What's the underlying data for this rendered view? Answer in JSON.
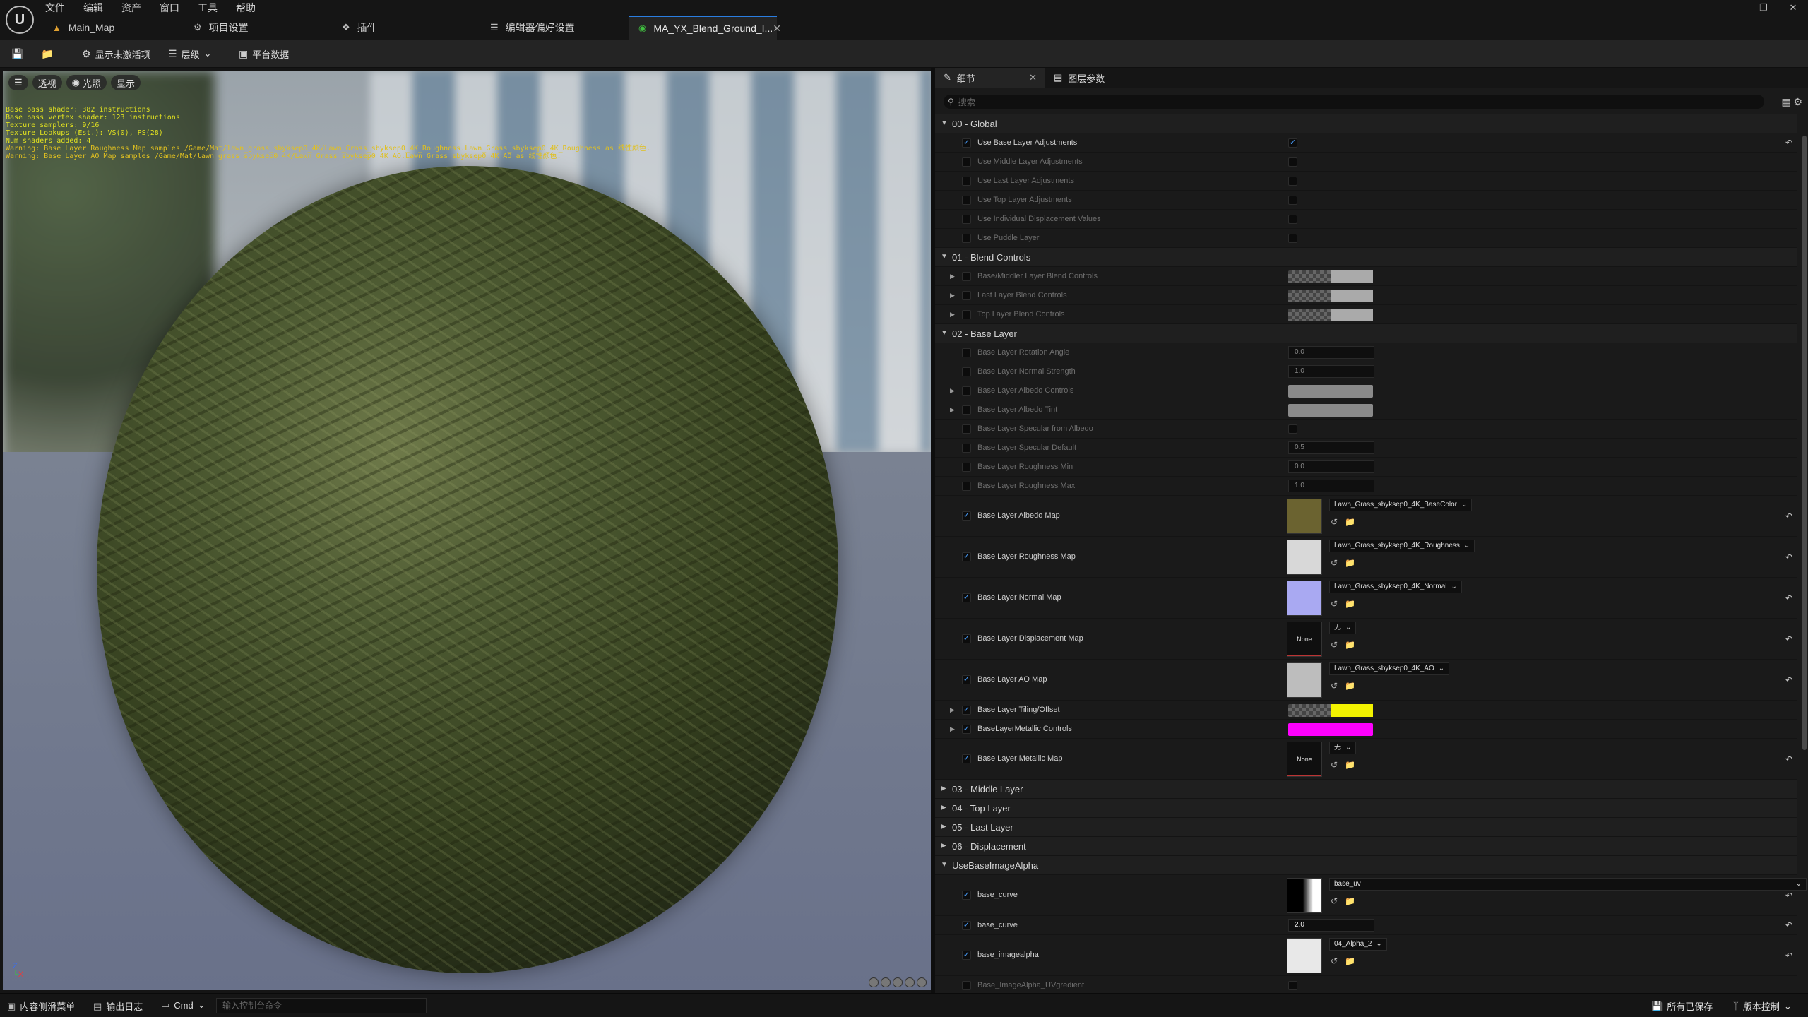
{
  "menu": [
    "文件",
    "编辑",
    "资产",
    "窗口",
    "工具",
    "帮助"
  ],
  "tabs": [
    {
      "label": "Main_Map",
      "icon": "map-icon"
    },
    {
      "label": "项目设置",
      "icon": "gear-icon"
    },
    {
      "label": "插件",
      "icon": "plugin-icon"
    },
    {
      "label": "编辑器偏好设置",
      "icon": "sliders-icon"
    },
    {
      "label": "MA_YX_Blend_Ground_I...",
      "icon": "material-icon",
      "active": true
    }
  ],
  "toolbar": {
    "show_inactive": "显示未激活项",
    "hierarchy": "层级",
    "platform_stats": "平台数据"
  },
  "viewport": {
    "perspective": "透视",
    "lit": "光照",
    "show": "显示",
    "stats": [
      "Base pass shader: 382 instructions",
      "Base pass vertex shader: 123 instructions",
      "Texture samplers: 9/16",
      "Texture Lookups (Est.): VS(0), PS(28)",
      "Num shaders added: 4",
      "Warning: Base Layer Roughness Map samples /Game/Mat/lawn_grass_sbyksep0_4K/Lawn_Grass_sbyksep0_4K_Roughness.Lawn_Grass_sbyksep0_4K_Roughness as 线性颜色.",
      "Warning: Base Layer AO Map samples /Game/Mat/lawn_grass_sbyksep0_4K/Lawn_Grass_sbyksep0_4K_AO.Lawn_Grass_sbyksep0_4K_AO as 线性颜色."
    ]
  },
  "panel": {
    "tab_details": "细节",
    "tab_layer_params": "图层参数",
    "search_placeholder": "搜索",
    "rows": [
      {
        "kind": "cat",
        "label": "00 - Global",
        "open": true
      },
      {
        "kind": "bool",
        "label": "Use Base Layer Adjustments",
        "checked": true,
        "value": true,
        "reset": true
      },
      {
        "kind": "bool",
        "label": "Use Middle Layer Adjustments",
        "dim": true
      },
      {
        "kind": "bool",
        "label": "Use Last Layer Adjustments",
        "dim": true
      },
      {
        "kind": "bool",
        "label": "Use Top Layer Adjustments",
        "dim": true
      },
      {
        "kind": "bool",
        "label": "Use Individual Displacement Values",
        "dim": true
      },
      {
        "kind": "bool",
        "label": "Use Puddle Layer",
        "dim": true
      },
      {
        "kind": "cat",
        "label": "01 - Blend Controls",
        "open": true
      },
      {
        "kind": "swatch",
        "label": "Base/Middler Layer Blend Controls",
        "dim": true,
        "expand": true,
        "swatch": "checker-half"
      },
      {
        "kind": "swatch",
        "label": "Last Layer Blend Controls",
        "dim": true,
        "expand": true,
        "swatch": "checker-half"
      },
      {
        "kind": "swatch",
        "label": "Top Layer Blend Controls",
        "dim": true,
        "expand": true,
        "swatch": "checker-half"
      },
      {
        "kind": "cat",
        "label": "02 - Base Layer",
        "open": true
      },
      {
        "kind": "num",
        "label": "Base Layer Rotation Angle",
        "dim": true,
        "value": "0.0"
      },
      {
        "kind": "num",
        "label": "Base Layer Normal Strength",
        "dim": true,
        "value": "1.0"
      },
      {
        "kind": "swatch",
        "label": "Base Layer Albedo Controls",
        "dim": true,
        "expand": true,
        "swatch": "#8a8a8a"
      },
      {
        "kind": "swatch",
        "label": "Base Layer Albedo Tint",
        "dim": true,
        "expand": true,
        "swatch": "#8a8a8a"
      },
      {
        "kind": "bool",
        "label": "Base Layer Specular from Albedo",
        "dim": true
      },
      {
        "kind": "num",
        "label": "Base Layer Specular Default",
        "dim": true,
        "value": "0.5"
      },
      {
        "kind": "num",
        "label": "Base Layer Roughness Min",
        "dim": true,
        "value": "0.0"
      },
      {
        "kind": "num",
        "label": "Base Layer Roughness Max",
        "dim": true,
        "value": "1.0"
      },
      {
        "kind": "tex",
        "label": "Base Layer Albedo Map",
        "checked": true,
        "asset": "Lawn_Grass_sbyksep0_4K_BaseColor",
        "thumb": "#6b6330",
        "reset": true
      },
      {
        "kind": "tex",
        "label": "Base Layer Roughness Map",
        "checked": true,
        "asset": "Lawn_Grass_sbyksep0_4K_Roughness",
        "thumb": "#d8d8d8",
        "reset": true
      },
      {
        "kind": "tex",
        "label": "Base Layer Normal Map",
        "checked": true,
        "asset": "Lawn_Grass_sbyksep0_4K_Normal",
        "thumb": "#a9a9f2",
        "reset": true
      },
      {
        "kind": "tex",
        "label": "Base Layer Displacement Map",
        "checked": true,
        "asset": "无",
        "thumb": "none",
        "none_label": "None",
        "reset": true
      },
      {
        "kind": "tex",
        "label": "Base Layer AO Map",
        "checked": true,
        "asset": "Lawn_Grass_sbyksep0_4K_AO",
        "thumb": "#bdbdbd",
        "reset": true
      },
      {
        "kind": "swatch",
        "label": "Base Layer Tiling/Offset",
        "checked": true,
        "expand": true,
        "swatch": "checker-yellow"
      },
      {
        "kind": "swatch",
        "label": "BaseLayerMetallic Controls",
        "checked": true,
        "expand": true,
        "swatch": "#ff00ff"
      },
      {
        "kind": "tex",
        "label": "Base Layer Metallic Map",
        "checked": true,
        "asset": "无",
        "thumb": "none",
        "none_label": "None",
        "reset": true
      },
      {
        "kind": "cat",
        "label": "03 - Middle Layer",
        "open": false
      },
      {
        "kind": "cat",
        "label": "04 - Top Layer",
        "open": false
      },
      {
        "kind": "cat",
        "label": "05 - Last Layer",
        "open": false
      },
      {
        "kind": "cat",
        "label": "06 - Displacement",
        "open": false
      },
      {
        "kind": "cat",
        "label": "UseBaseImageAlpha",
        "open": true
      },
      {
        "kind": "tex",
        "label": "base_curve",
        "checked": true,
        "asset": "base_uv",
        "thumb": "curve",
        "wide": true,
        "reset": true
      },
      {
        "kind": "num",
        "label": "base_curve",
        "checked": true,
        "value": "2.0",
        "bright": true,
        "reset": true
      },
      {
        "kind": "tex",
        "label": "base_imagealpha",
        "checked": true,
        "asset": "04_Alpha_2",
        "thumb": "#e8e8e8",
        "reset": true
      },
      {
        "kind": "bool",
        "label": "Base_ImageAlpha_UVgredient",
        "dim": true
      }
    ]
  },
  "status": {
    "content_drawer": "内容侧滑菜单",
    "output_log": "输出日志",
    "cmd": "Cmd",
    "console_placeholder": "输入控制台命令",
    "all_saved": "所有已保存",
    "source_control": "版本控制"
  }
}
